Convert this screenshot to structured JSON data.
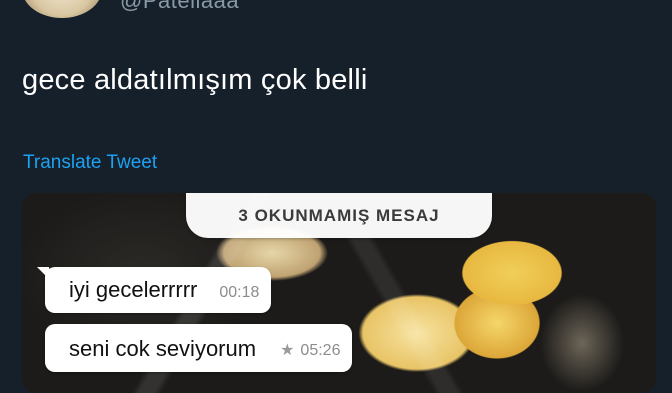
{
  "tweet": {
    "handle": "@Patellaaa",
    "text": "gece aldatılmışım çok belli",
    "translate_label": "Translate Tweet"
  },
  "screenshot": {
    "unread_banner": "3 OKUNMAMIŞ MESAJ",
    "messages": [
      {
        "text": "iyi gecelerrrrr",
        "time": "00:18",
        "starred": false
      },
      {
        "text": "seni cok seviyorum",
        "time": "05:26",
        "starred": true
      }
    ],
    "star_glyph": "★"
  }
}
